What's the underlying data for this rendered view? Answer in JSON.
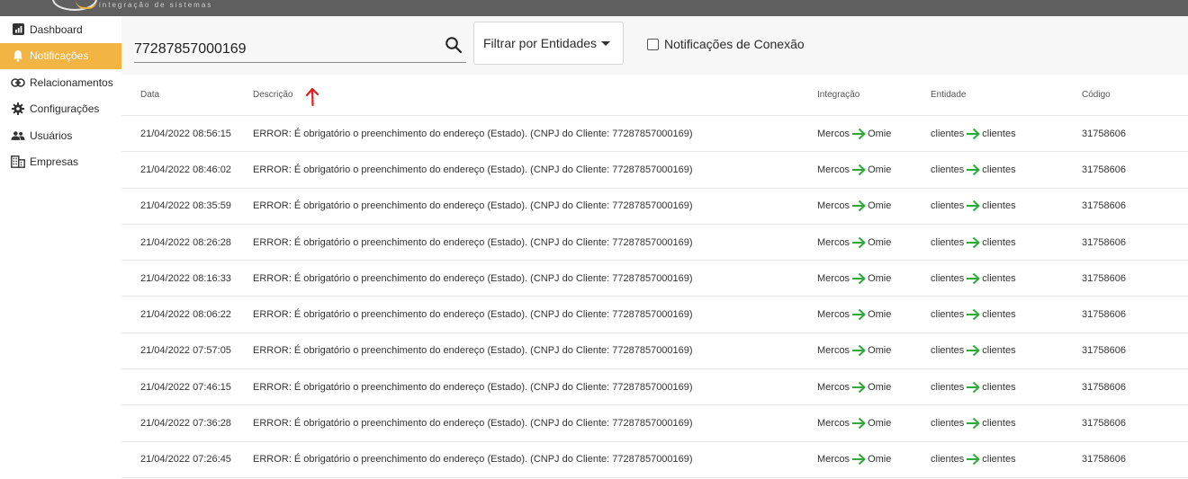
{
  "app": {
    "logo_subtitle": "integração de sistemas"
  },
  "sidebar": {
    "items": [
      {
        "label": "Dashboard",
        "icon": "chart-icon",
        "active": false
      },
      {
        "label": "Notificações",
        "icon": "bell-icon",
        "active": true
      },
      {
        "label": "Relacionamentos",
        "icon": "link-icon",
        "active": false
      },
      {
        "label": "Configurações",
        "icon": "gear-icon",
        "active": false
      },
      {
        "label": "Usuários",
        "icon": "users-icon",
        "active": false
      },
      {
        "label": "Empresas",
        "icon": "building-icon",
        "active": false
      }
    ]
  },
  "toolbar": {
    "search_value": "77287857000169",
    "filter_label": "Filtrar por Entidades",
    "connection_label": "Notificações de Conexão",
    "connection_checked": false
  },
  "annotation": {
    "mark": "red-arrow-up"
  },
  "table": {
    "columns": [
      "Data",
      "Descrição",
      "Integração",
      "Entidade",
      "Código"
    ],
    "rows": [
      {
        "data": "21/04/2022 08:56:15",
        "descricao": "ERROR: É obrigatório o preenchimento do endereço (Estado). (CNPJ do Cliente: 77287857000169)",
        "int_from": "Mercos",
        "int_to": "Omie",
        "ent_from": "clientes",
        "ent_to": "clientes",
        "codigo": "31758606"
      },
      {
        "data": "21/04/2022 08:46:02",
        "descricao": "ERROR: É obrigatório o preenchimento do endereço (Estado). (CNPJ do Cliente: 77287857000169)",
        "int_from": "Mercos",
        "int_to": "Omie",
        "ent_from": "clientes",
        "ent_to": "clientes",
        "codigo": "31758606"
      },
      {
        "data": "21/04/2022 08:35:59",
        "descricao": "ERROR: É obrigatório o preenchimento do endereço (Estado). (CNPJ do Cliente: 77287857000169)",
        "int_from": "Mercos",
        "int_to": "Omie",
        "ent_from": "clientes",
        "ent_to": "clientes",
        "codigo": "31758606"
      },
      {
        "data": "21/04/2022 08:26:28",
        "descricao": "ERROR: É obrigatório o preenchimento do endereço (Estado). (CNPJ do Cliente: 77287857000169)",
        "int_from": "Mercos",
        "int_to": "Omie",
        "ent_from": "clientes",
        "ent_to": "clientes",
        "codigo": "31758606"
      },
      {
        "data": "21/04/2022 08:16:33",
        "descricao": "ERROR: É obrigatório o preenchimento do endereço (Estado). (CNPJ do Cliente: 77287857000169)",
        "int_from": "Mercos",
        "int_to": "Omie",
        "ent_from": "clientes",
        "ent_to": "clientes",
        "codigo": "31758606"
      },
      {
        "data": "21/04/2022 08:06:22",
        "descricao": "ERROR: É obrigatório o preenchimento do endereço (Estado). (CNPJ do Cliente: 77287857000169)",
        "int_from": "Mercos",
        "int_to": "Omie",
        "ent_from": "clientes",
        "ent_to": "clientes",
        "codigo": "31758606"
      },
      {
        "data": "21/04/2022 07:57:05",
        "descricao": "ERROR: É obrigatório o preenchimento do endereço (Estado). (CNPJ do Cliente: 77287857000169)",
        "int_from": "Mercos",
        "int_to": "Omie",
        "ent_from": "clientes",
        "ent_to": "clientes",
        "codigo": "31758606"
      },
      {
        "data": "21/04/2022 07:46:15",
        "descricao": "ERROR: É obrigatório o preenchimento do endereço (Estado). (CNPJ do Cliente: 77287857000169)",
        "int_from": "Mercos",
        "int_to": "Omie",
        "ent_from": "clientes",
        "ent_to": "clientes",
        "codigo": "31758606"
      },
      {
        "data": "21/04/2022 07:36:28",
        "descricao": "ERROR: É obrigatório o preenchimento do endereço (Estado). (CNPJ do Cliente: 77287857000169)",
        "int_from": "Mercos",
        "int_to": "Omie",
        "ent_from": "clientes",
        "ent_to": "clientes",
        "codigo": "31758606"
      },
      {
        "data": "21/04/2022 07:26:45",
        "descricao": "ERROR: É obrigatório o preenchimento do endereço (Estado). (CNPJ do Cliente: 77287857000169)",
        "int_from": "Mercos",
        "int_to": "Omie",
        "ent_from": "clientes",
        "ent_to": "clientes",
        "codigo": "31758606"
      }
    ]
  },
  "colors": {
    "accent": "#f2b443",
    "arrow": "#2eaa3a",
    "annotation": "#e02020",
    "topbar": "#5f5f5f"
  }
}
